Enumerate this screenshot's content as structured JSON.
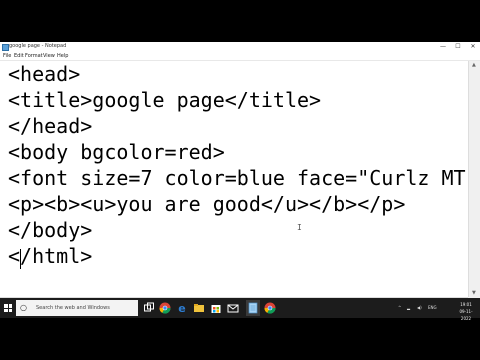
{
  "window": {
    "title": "google page - Notepad",
    "controls": {
      "minimize": "—",
      "maximize": "☐",
      "close": "✕"
    }
  },
  "menu": [
    "File",
    "Edit",
    "Format",
    "View",
    "Help"
  ],
  "editor": {
    "lines": [
      "<head>",
      "<title>google page</title>",
      "</head>",
      "<body bgcolor=red>",
      "<font size=7 color=blue face=\"Curlz MT",
      "<p><b><u>you are good</u></b></p>",
      "</body>",
      "</html>"
    ]
  },
  "taskbar": {
    "search_placeholder": "Search the web and Windows",
    "apps": [
      "task-view",
      "edge",
      "chrome",
      "file-explorer",
      "store",
      "mail",
      "notepad",
      "chrome"
    ],
    "tray": {
      "lang": "ENG",
      "time": "19:01",
      "date": "09-11-2022"
    }
  },
  "colors": {
    "taskbar": "#1c1c1c",
    "edge": "#2d7dd2",
    "chrome_red": "#db4437",
    "chrome_yellow": "#f4b400",
    "chrome_green": "#0f9d58",
    "explorer": "#f0c33c"
  }
}
